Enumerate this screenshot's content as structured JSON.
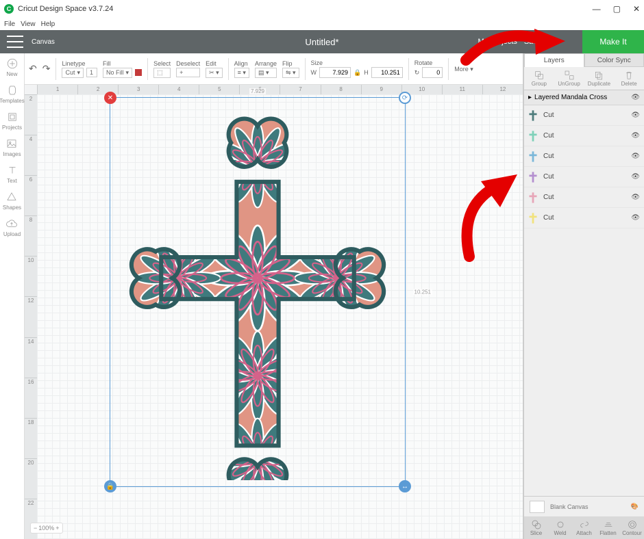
{
  "app": {
    "title": "Cricut Design Space v3.7.24",
    "logo_letter": "C"
  },
  "window_controls": {
    "min": "—",
    "max": "▢",
    "close": "✕"
  },
  "menu": [
    "File",
    "View",
    "Help"
  ],
  "topbar": {
    "canvas_label": "Canvas",
    "project_name": "Untitled*",
    "my_projects": "My Projects",
    "save": "Save",
    "machine": "",
    "makeit": "Make It"
  },
  "sidebar": [
    {
      "name": "new",
      "label": "New"
    },
    {
      "name": "templates",
      "label": "Templates"
    },
    {
      "name": "projects",
      "label": "Projects"
    },
    {
      "name": "images",
      "label": "Images"
    },
    {
      "name": "text",
      "label": "Text"
    },
    {
      "name": "shapes",
      "label": "Shapes"
    },
    {
      "name": "upload",
      "label": "Upload"
    }
  ],
  "toolbar": {
    "undo": "↶",
    "redo": "↷",
    "linetype_label": "Linetype",
    "linetype_value": "Cut",
    "linetype_weight": "1",
    "fill_label": "Fill",
    "fill_value": "No Fill",
    "select_label": "Select",
    "deselect_label": "Deselect",
    "edit_label": "Edit",
    "align_label": "Align",
    "arrange_label": "Arrange",
    "flip_label": "Flip",
    "size_label": "Size",
    "w": "W",
    "w_value": "7.929",
    "h": "H",
    "h_value": "10.251",
    "lock": "🔒",
    "rotate_label": "Rotate",
    "rotate_value": "0",
    "more_label": "More ▾"
  },
  "ruler_h": [
    "1",
    "2",
    "3",
    "4",
    "5",
    "6",
    "7",
    "8",
    "9",
    "10",
    "11",
    "12"
  ],
  "ruler_v": [
    "2",
    "4",
    "6",
    "8",
    "10",
    "12",
    "14",
    "16",
    "18",
    "20",
    "22"
  ],
  "dims": {
    "w": "7.929",
    "h": "10.251"
  },
  "zoom": {
    "minus": "−",
    "pct": "100%",
    "plus": "+"
  },
  "panel": {
    "tab_layers": "Layers",
    "tab_colorsync": "Color Sync",
    "action_group": "Group",
    "action_ungroup": "UnGroup",
    "action_duplicate": "Duplicate",
    "action_delete": "Delete",
    "group_name": "Layered Mandala Cross",
    "layers": [
      {
        "label": "Cut",
        "color": "#4e7c7c"
      },
      {
        "label": "Cut",
        "color": "#7fd1b9"
      },
      {
        "label": "Cut",
        "color": "#7bb7d9"
      },
      {
        "label": "Cut",
        "color": "#b48fcf"
      },
      {
        "label": "Cut",
        "color": "#e7a6b8"
      },
      {
        "label": "Cut",
        "color": "#f1e27d"
      }
    ],
    "blank_label": "Blank Canvas",
    "bottom": [
      {
        "name": "slice",
        "label": "Slice"
      },
      {
        "name": "weld",
        "label": "Weld"
      },
      {
        "name": "attach",
        "label": "Attach"
      },
      {
        "name": "flatten",
        "label": "Flatten"
      },
      {
        "name": "contour",
        "label": "Contour"
      }
    ]
  }
}
